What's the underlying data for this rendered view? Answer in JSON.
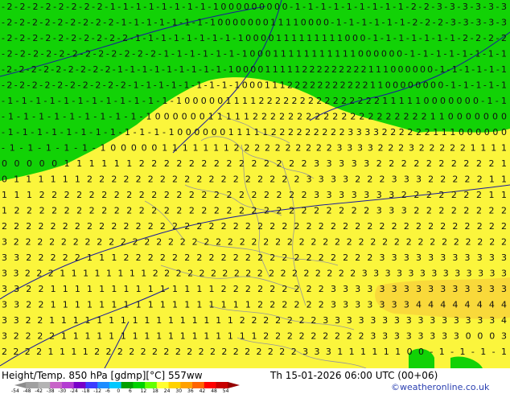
{
  "header": {
    "title": "Height/Temp. 850 hPa [gdmp][°C] 557ww",
    "valid_time": "Th 15-01-2026 06:00 UTC (00+06)",
    "credit": "©weatheronline.co.uk"
  },
  "legend": {
    "labels": [
      "-54",
      "-48",
      "-42",
      "-38",
      "-30",
      "-24",
      "-18",
      "-12",
      "-6",
      "0",
      "6",
      "12",
      "18",
      "24",
      "30",
      "36",
      "42",
      "48",
      "54"
    ],
    "colors": [
      "#8c8c8c",
      "#a0a0a0",
      "#b4b4b4",
      "#c864c8",
      "#b43cd2",
      "#7800c8",
      "#3c3cff",
      "#1e8cff",
      "#00c8ff",
      "#00a000",
      "#00d200",
      "#64ff00",
      "#ffff32",
      "#ffd200",
      "#ffa000",
      "#ff6400",
      "#ff0000",
      "#c80000",
      "#960000"
    ]
  },
  "map": {
    "colors": {
      "green": "#12d206",
      "yellow": "#fbf53c",
      "orange_band": "#f8d43a",
      "contour": "#1a1a9c",
      "border": "#8a8aa8"
    },
    "rows": [
      "-2-2-2-2-2-2-2-2-1-1-1-1-1-1-1-1-1000000000-1-1-1-1-1-1-1-1-1-2-2-3-3-3-3-3-3",
      "-2-2-2-2-2-2-2-2-2-1-1-1-1-1-1-1-1000000011110000-1-1-1-1-1-1-2-2-2-3-3-3-3-3",
      "-2-2-2-2-2-2-2-2-2-2-1-1-1-1-1-1-1-1-10000111111111000-1-1-1-1-1-1-1-2-2-2-2",
      "-2-2-2-2-2-2-2-2-2-2-2-2-1-1-1-1-1-1-100011111111111000000-1-1-1-1-1-1-1-1",
      "-2-2-2-2-2-2-2-2-2-1-1-1-1-1-1-1-1-1-1000011111222222222111000000-1-1-1-1-1-1",
      "-2-2-2-2-2-2-2-2-2-2-1-1-1-1-1-1-1-1-1000111222222222221100000000-1-1-1-1-1",
      "-1-1-1-1-1-1-1-1-1-1-1-1-1000001111222222222222222111110000000-1-1",
      "-1-1-1-1-1-1-1-1-1-10000001111122222222222222222222110000000",
      "-1-1-1-1-1-1-1-1-1-1-1-1000000111112222222223333222222111000000",
      "-1-1-1-1-1-1000001111111222222222233332223222221111",
      "00000111111222222222222223333322222222221",
      "011111122222222222222222233332223332222211",
      "11122222222222222222222223333333222222211",
      "12222222222222222222222222222233322222222",
      "222222222222222222222222222222222222222222",
      "3222222222222222222222222222222222222222222",
      "332222211122222222222222222222233333333333",
      "33222111111112222222222222222223333333333333",
      "332211111111111111222222222333333333333333",
      "332211111111111111111222222333333344444444",
      "3322111111111111111122222223333333333333334",
      "3222211111111111111111222222222333333330003",
      "2222111122222222222222222233311111100-1-1-1-1"
    ]
  }
}
